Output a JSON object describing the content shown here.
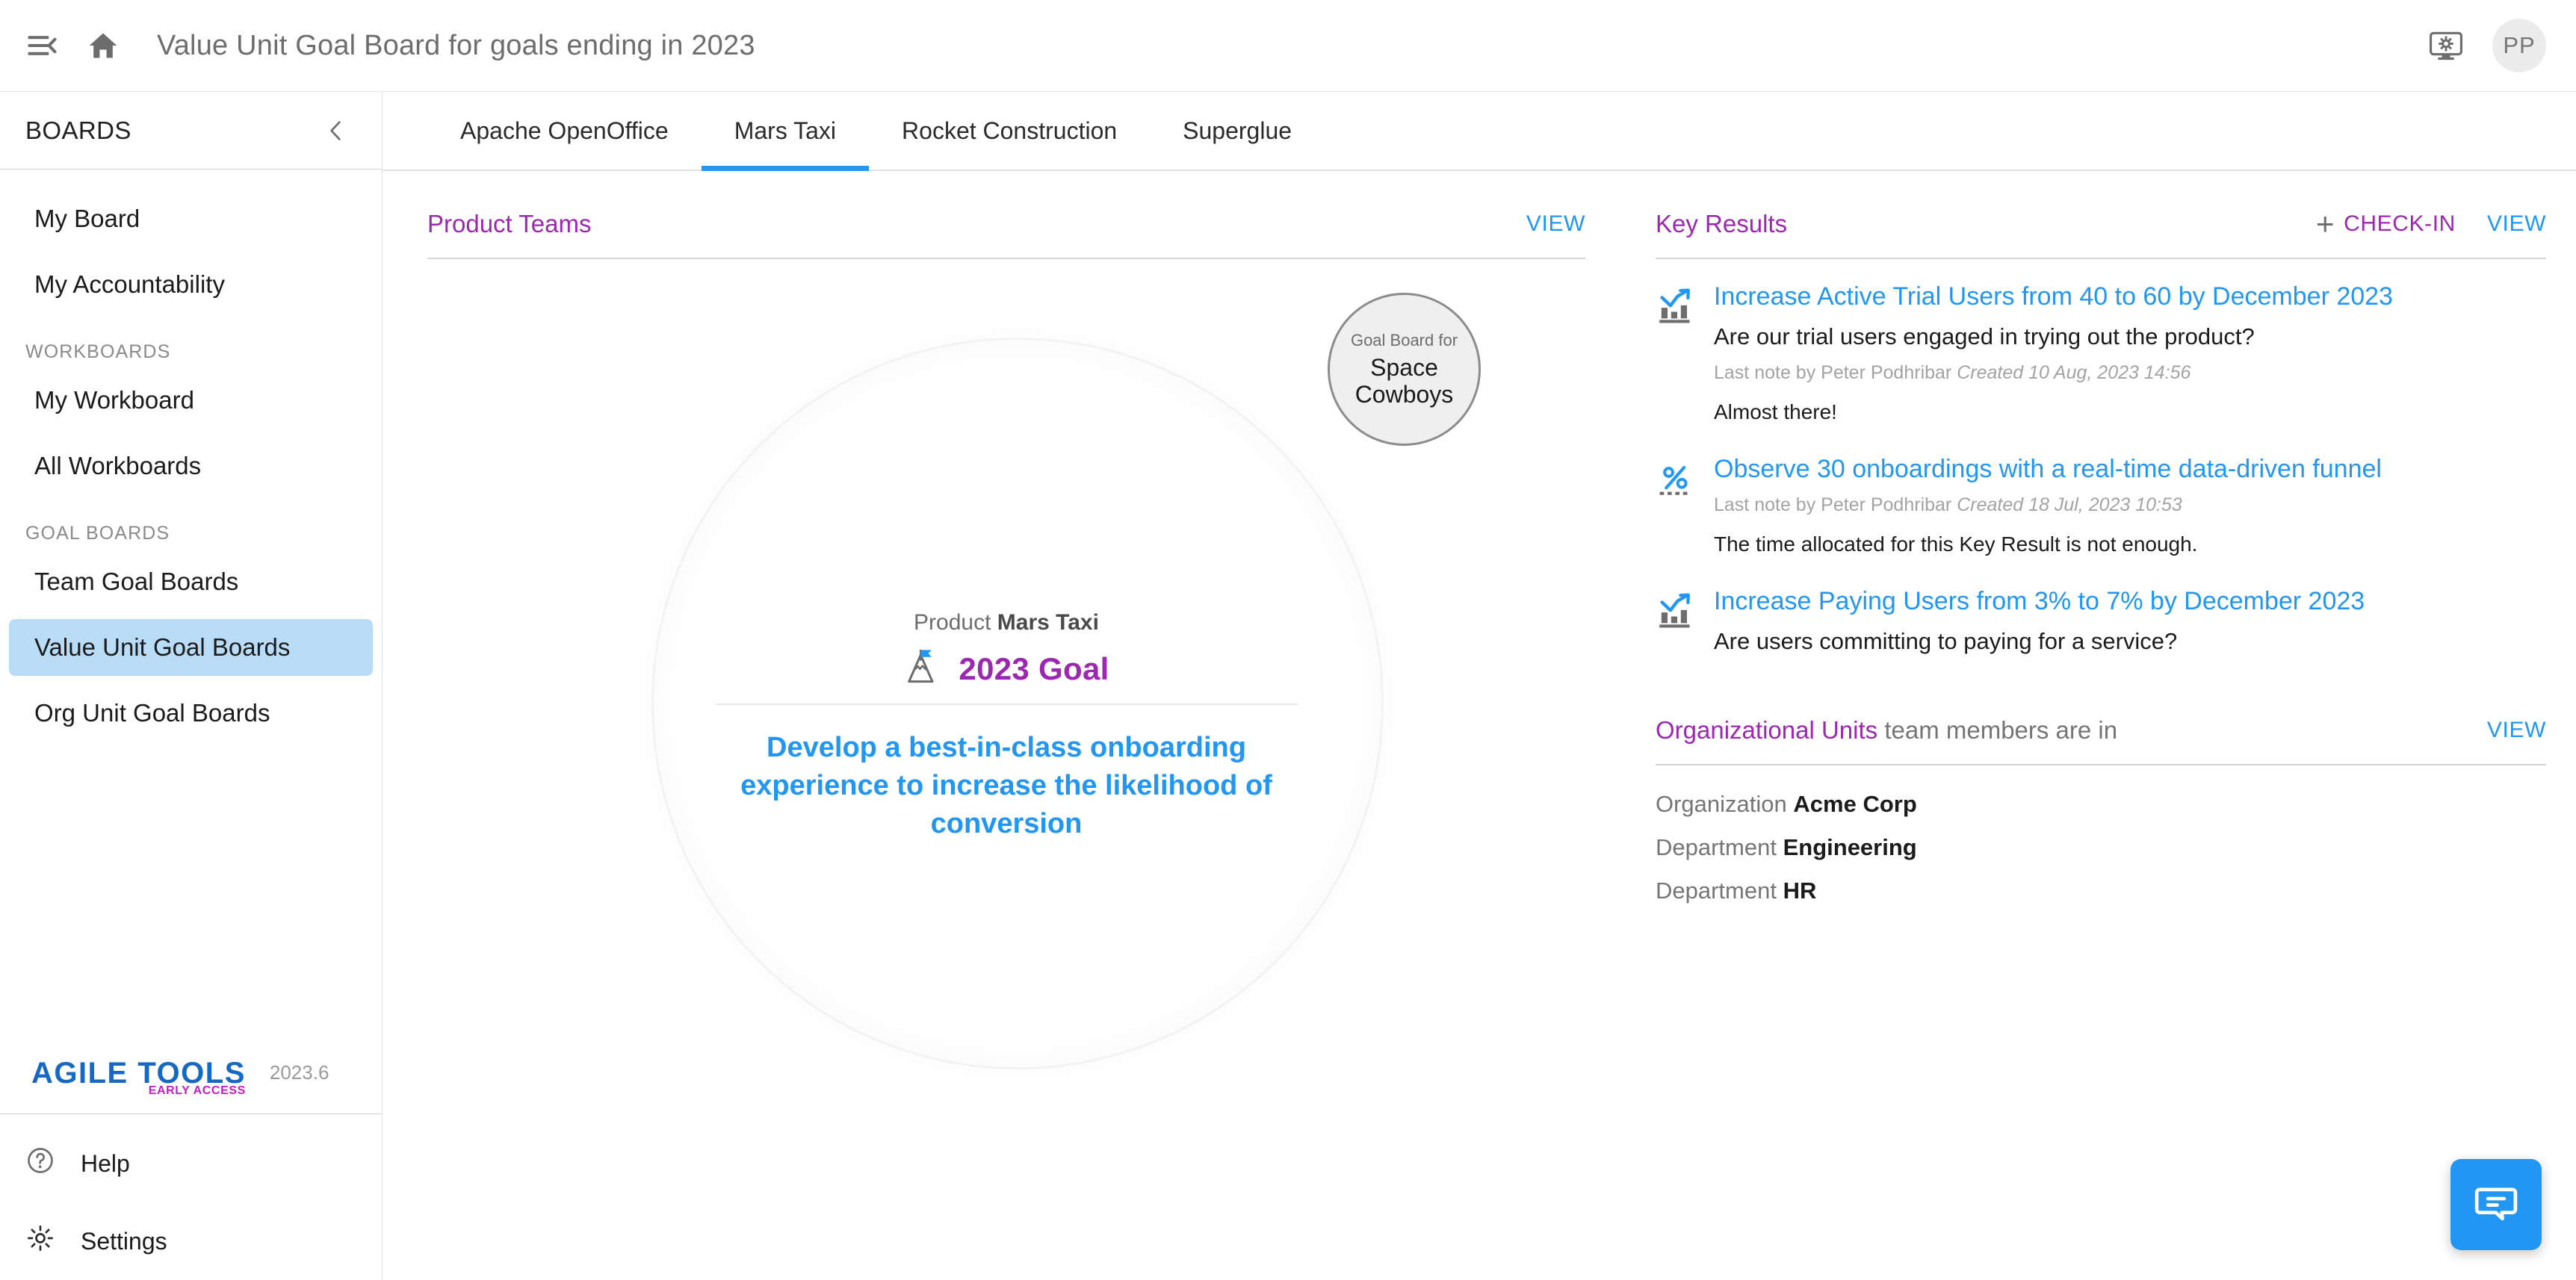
{
  "topbar": {
    "menu_icon": "menu-collapse-icon",
    "home_icon": "home-icon",
    "title": "Value Unit Goal Board for goals ending in 2023",
    "system_icon": "monitor-gear-icon",
    "avatar_initials": "PP"
  },
  "sidebar": {
    "header": "BOARDS",
    "collapse_icon": "chevron-left-icon",
    "items": [
      {
        "label": "My Board",
        "active": false
      },
      {
        "label": "My Accountability",
        "active": false
      }
    ],
    "group_workboards": "WORKBOARDS",
    "workboards": [
      {
        "label": "My Workboard",
        "active": false
      },
      {
        "label": "All Workboards",
        "active": false
      }
    ],
    "group_goal_boards": "GOAL BOARDS",
    "goal_boards": [
      {
        "label": "Team Goal Boards",
        "active": false
      },
      {
        "label": "Value Unit Goal Boards",
        "active": true
      },
      {
        "label": "Org Unit Goal Boards",
        "active": false
      }
    ],
    "logo": {
      "name": "AGILE TOOLS",
      "tagline": "EARLY ACCESS",
      "version": "2023.6",
      "name_color": "#1668c3",
      "tagline_color": "#c21fc2"
    },
    "footer": [
      {
        "label": "Help",
        "icon": "help-circle-icon"
      },
      {
        "label": "Settings",
        "icon": "gear-icon"
      }
    ]
  },
  "tabs": [
    {
      "label": "Apache OpenOffice",
      "active": false
    },
    {
      "label": "Mars Taxi",
      "active": true
    },
    {
      "label": "Rocket Construction",
      "active": false
    },
    {
      "label": "Superglue",
      "active": false
    }
  ],
  "product_teams": {
    "title": "Product Teams",
    "view_label": "VIEW",
    "node": {
      "kicker": "Goal Board for",
      "name": "Space Cowboys"
    },
    "goal": {
      "product_label": "Product",
      "product_name": "Mars Taxi",
      "icon": "mountain-flag-icon",
      "year_label": "2023 Goal",
      "text": "Develop a best-in-class onboarding experience to increase the likelihood of conversion"
    }
  },
  "key_results": {
    "title": "Key Results",
    "checkin_label": "CHECK-IN",
    "checkin_icon": "plus-icon",
    "view_label": "VIEW",
    "items": [
      {
        "icon": "bar-chart-trend-icon",
        "title": "Increase Active Trial Users from 40 to 60 by December 2023",
        "question": "Are our trial users engaged in trying out the product?",
        "note_author": "Last note by Peter Podhribar",
        "note_created": "Created 10 Aug, 2023 14:56",
        "note": "Almost there!"
      },
      {
        "icon": "percent-icon",
        "title": "Observe 30 onboardings with a real-time data-driven funnel",
        "question": "",
        "note_author": "Last note by Peter Podhribar",
        "note_created": "Created 18 Jul, 2023 10:53",
        "note": "The time allocated for this Key Result is not enough."
      },
      {
        "icon": "bar-chart-trend-icon",
        "title": "Increase Paying Users from 3% to 7% by December 2023",
        "question": "Are users committing to paying for a service?",
        "note_author": "",
        "note_created": "",
        "note": ""
      }
    ]
  },
  "org_units": {
    "title": "Organizational Units",
    "subtitle": "team members are in",
    "view_label": "VIEW",
    "rows": [
      {
        "label": "Organization",
        "value": "Acme Corp"
      },
      {
        "label": "Department",
        "value": "Engineering"
      },
      {
        "label": "Department",
        "value": "HR"
      }
    ]
  },
  "chat": {
    "icon": "chat-bubble-icon"
  },
  "colors": {
    "accent_blue": "#2196f3",
    "accent_purple": "#9c27b0",
    "selected_nav": "#b9dcf7"
  }
}
